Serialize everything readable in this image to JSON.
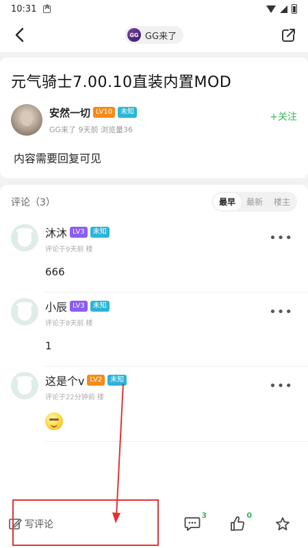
{
  "status_bar": {
    "time": "10:31",
    "notif_icon": "a-badge-icon"
  },
  "top_bar": {
    "tag_logo": "GG",
    "tag_label": "GG来了"
  },
  "post": {
    "title": "元气骑士7.00.10直装内置MOD",
    "author": {
      "name": "安然一切",
      "level": "LV10",
      "status": "未知",
      "meta": "GG来了 9天前 浏览量36"
    },
    "follow_label": "+关注",
    "content": "内容需要回复可见"
  },
  "comments": {
    "header": "评论（3）",
    "sort_tabs": [
      "最早",
      "最新",
      "楼主"
    ],
    "active_sort": "最早",
    "items": [
      {
        "name": "沐沐",
        "level": "LV3",
        "status": "未知",
        "meta": "评论于9天前 楼",
        "text": "666"
      },
      {
        "name": "小辰",
        "level": "LV3",
        "status": "未知",
        "meta": "评论于8天前 楼",
        "text": "1"
      },
      {
        "name": "这是个v",
        "level": "LV2",
        "status": "未知",
        "meta": "评论于22分钟前 楼",
        "text": ""
      }
    ]
  },
  "bottom_bar": {
    "write_label": "写评论",
    "comment_count": "3",
    "like_count": "0"
  },
  "colors": {
    "accent_green": "#3cb45a",
    "highlight_red": "#e53030"
  }
}
